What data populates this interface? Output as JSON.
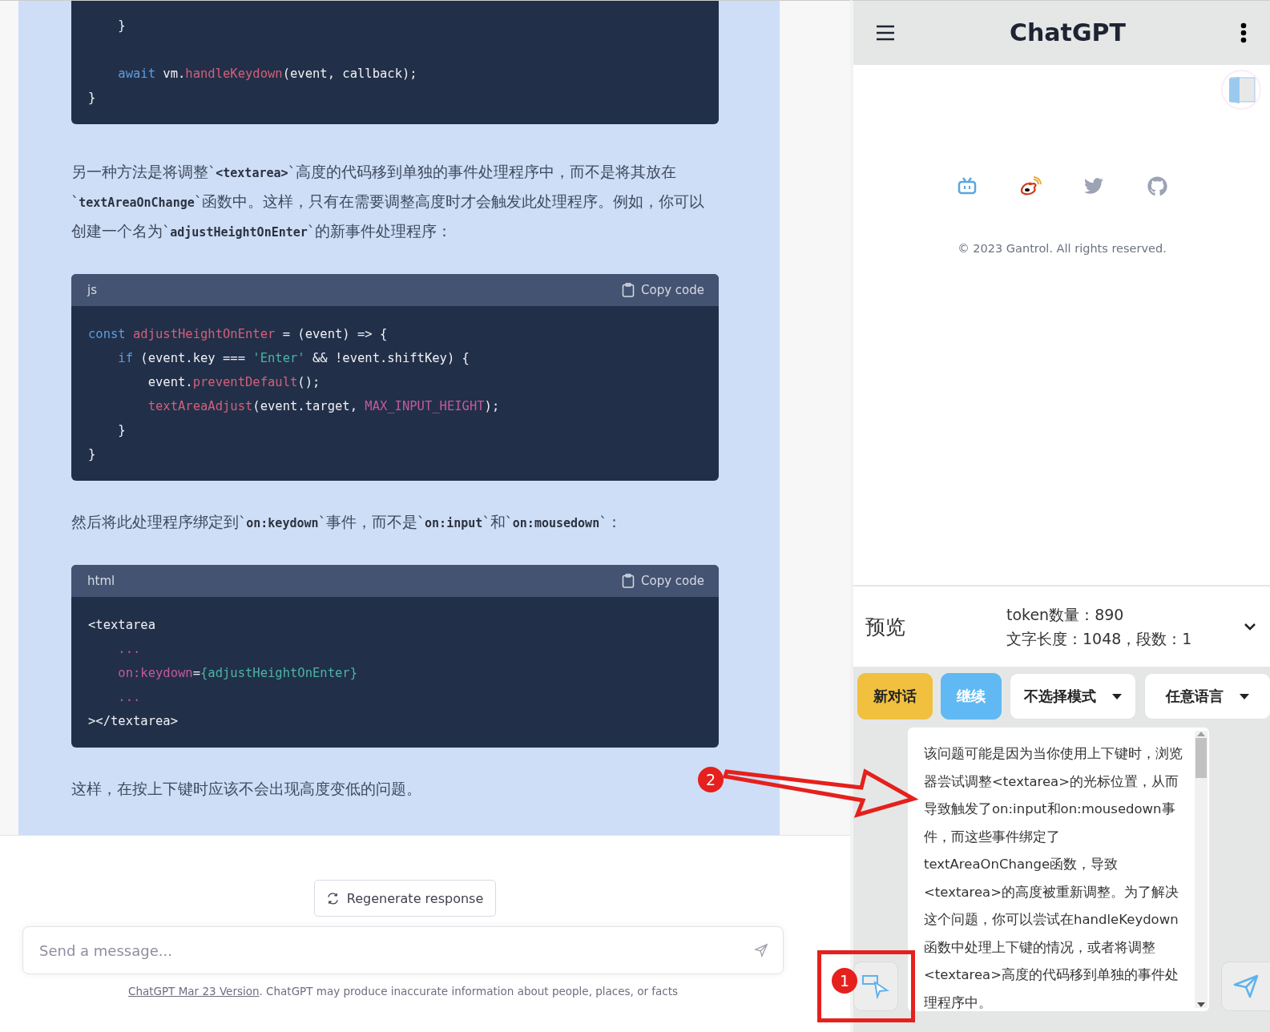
{
  "conversation": [
    {
      "kind": "code",
      "lines": [
        {
          "kind": "text",
          "tokens": [
            {
              "text": "    }",
              "kind": "plain"
            }
          ]
        },
        {
          "kind": "blank"
        },
        {
          "kind": "text",
          "tokens": [
            {
              "text": "    await",
              "kind": "keyword"
            },
            {
              "text": " vm.",
              "kind": "plain"
            },
            {
              "text": "handleKeydown",
              "kind": "name"
            },
            {
              "text": "(event, callback);",
              "kind": "plain"
            }
          ]
        },
        {
          "kind": "text",
          "tokens": [
            {
              "text": "}",
              "kind": "plain"
            }
          ]
        }
      ]
    },
    {
      "kind": "paragraph",
      "segments": [
        {
          "text": "另一种方法是将调整`",
          "kind": "text"
        },
        {
          "text": "<textarea>",
          "kind": "code"
        },
        {
          "text": "`高度的代码移到单独的事件处理程序中，而不是将其放在`",
          "kind": "text"
        },
        {
          "text": "textAreaOnChange",
          "kind": "code"
        },
        {
          "text": "`函数中。这样，只有在需要调整高度时才会触发此处理程序。例如，你可以创建一个名为`",
          "kind": "text"
        },
        {
          "text": "adjustHeightOnEnter",
          "kind": "code"
        },
        {
          "text": "`的新事件处理程序：",
          "kind": "text"
        }
      ]
    },
    {
      "kind": "code",
      "language": "js",
      "copy_label": "Copy code",
      "lines": [
        {
          "tokens": [
            {
              "text": "const",
              "kind": "keyword"
            },
            {
              "text": " adjustHeightOnEnter",
              "kind": "name"
            },
            {
              "text": " = (event) => {",
              "kind": "plain"
            }
          ]
        },
        {
          "tokens": [
            {
              "text": "    if",
              "kind": "keyword"
            },
            {
              "text": " (event.key === ",
              "kind": "plain"
            },
            {
              "text": "'Enter'",
              "kind": "string"
            },
            {
              "text": " && !event.shiftKey) {",
              "kind": "plain"
            }
          ]
        },
        {
          "tokens": [
            {
              "text": "        event.",
              "kind": "plain"
            },
            {
              "text": "preventDefault",
              "kind": "name"
            },
            {
              "text": "();",
              "kind": "plain"
            }
          ]
        },
        {
          "tokens": [
            {
              "text": "        textAreaAdjust",
              "kind": "name"
            },
            {
              "text": "(event.target, ",
              "kind": "plain"
            },
            {
              "text": "MAX_INPUT_HEIGHT",
              "kind": "constant"
            },
            {
              "text": ");",
              "kind": "plain"
            }
          ]
        },
        {
          "tokens": [
            {
              "text": "    }",
              "kind": "plain"
            }
          ]
        },
        {
          "tokens": [
            {
              "text": "}",
              "kind": "plain"
            }
          ]
        }
      ]
    },
    {
      "kind": "paragraph",
      "segments": [
        {
          "text": "然后将此处理程序绑定到`",
          "kind": "text"
        },
        {
          "text": "on:keydown",
          "kind": "code"
        },
        {
          "text": "`事件，而不是`",
          "kind": "text"
        },
        {
          "text": "on:input",
          "kind": "code"
        },
        {
          "text": "`和`",
          "kind": "text"
        },
        {
          "text": "on:mousedown",
          "kind": "code"
        },
        {
          "text": "`：",
          "kind": "text"
        }
      ]
    },
    {
      "kind": "code",
      "language": "html",
      "copy_label": "Copy code",
      "lines": [
        {
          "tokens": [
            {
              "text": "<textarea",
              "kind": "plain"
            }
          ]
        },
        {
          "tokens": [
            {
              "text": "    ...",
              "kind": "constant"
            }
          ]
        },
        {
          "tokens": [
            {
              "text": "    on:keydown",
              "kind": "constant"
            },
            {
              "text": "=",
              "kind": "plain"
            },
            {
              "text": "{adjustHeightOnEnter}",
              "kind": "string"
            }
          ]
        },
        {
          "tokens": [
            {
              "text": "    ...",
              "kind": "constant"
            }
          ]
        },
        {
          "tokens": [
            {
              "text": "></textarea>",
              "kind": "plain"
            }
          ]
        }
      ]
    },
    {
      "kind": "paragraph",
      "segments": [
        {
          "text": "这样，在按上下键时应该不会出现高度变低的问题。",
          "kind": "text"
        }
      ]
    }
  ],
  "regenerate_button": "Regenerate response",
  "message_input": {
    "placeholder": "Send a message..."
  },
  "footer": {
    "link": "ChatGPT Mar 23 Version",
    "text": ". ChatGPT may produce inaccurate information about people, places, or facts"
  },
  "side_panel": {
    "title": "ChatGPT",
    "social_links": [
      {
        "kind": "tv"
      },
      {
        "kind": "weibo"
      },
      {
        "kind": "bird"
      },
      {
        "kind": "cat"
      }
    ],
    "copyright": "© 2023 Gantrol. All rights reserved.",
    "preview": {
      "label": "预览",
      "token_count": "token数量：890",
      "length": "文字长度：1048，段数：1"
    },
    "actions": [
      {
        "label": "新对话",
        "kind": "primary"
      },
      {
        "label": "继续",
        "kind": "secondary"
      },
      {
        "label": "不选择模式",
        "kind": "dropdown"
      },
      {
        "label": "任意语言",
        "kind": "dropdown"
      }
    ],
    "message_text": "该问题可能是因为当你使用上下键时，浏览器尝试调整<textarea>的光标位置，从而导致触发了on:input和on:mousedown事件，而这些事件绑定了textAreaOnChange函数，导致<textarea>的高度被重新调整。为了解决这个问题，你可以尝试在handleKeydown函数中处理上下键的情况，或者将调整<textarea>高度的代码移到单独的事件处理程序中。"
  },
  "annotations": [
    {
      "label": "1"
    },
    {
      "label": "2"
    }
  ]
}
